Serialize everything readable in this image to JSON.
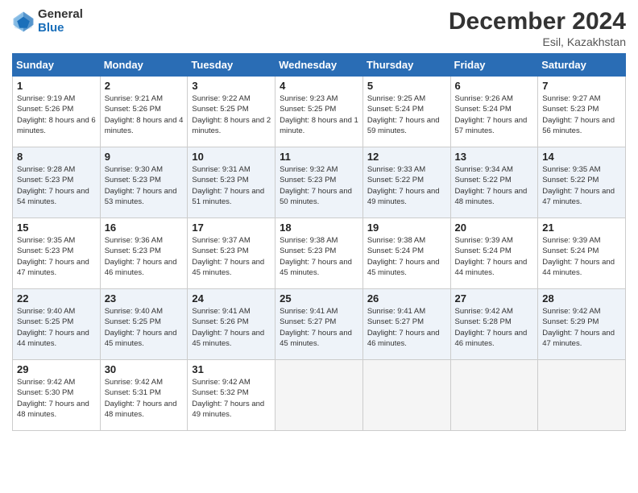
{
  "header": {
    "logo_text_general": "General",
    "logo_text_blue": "Blue",
    "month_title": "December 2024",
    "location": "Esil, Kazakhstan"
  },
  "days_of_week": [
    "Sunday",
    "Monday",
    "Tuesday",
    "Wednesday",
    "Thursday",
    "Friday",
    "Saturday"
  ],
  "weeks": [
    [
      {
        "day": "1",
        "sunrise": "9:19 AM",
        "sunset": "5:26 PM",
        "daylight": "8 hours and 6 minutes."
      },
      {
        "day": "2",
        "sunrise": "9:21 AM",
        "sunset": "5:26 PM",
        "daylight": "8 hours and 4 minutes."
      },
      {
        "day": "3",
        "sunrise": "9:22 AM",
        "sunset": "5:25 PM",
        "daylight": "8 hours and 2 minutes."
      },
      {
        "day": "4",
        "sunrise": "9:23 AM",
        "sunset": "5:25 PM",
        "daylight": "8 hours and 1 minute."
      },
      {
        "day": "5",
        "sunrise": "9:25 AM",
        "sunset": "5:24 PM",
        "daylight": "7 hours and 59 minutes."
      },
      {
        "day": "6",
        "sunrise": "9:26 AM",
        "sunset": "5:24 PM",
        "daylight": "7 hours and 57 minutes."
      },
      {
        "day": "7",
        "sunrise": "9:27 AM",
        "sunset": "5:23 PM",
        "daylight": "7 hours and 56 minutes."
      }
    ],
    [
      {
        "day": "8",
        "sunrise": "9:28 AM",
        "sunset": "5:23 PM",
        "daylight": "7 hours and 54 minutes."
      },
      {
        "day": "9",
        "sunrise": "9:30 AM",
        "sunset": "5:23 PM",
        "daylight": "7 hours and 53 minutes."
      },
      {
        "day": "10",
        "sunrise": "9:31 AM",
        "sunset": "5:23 PM",
        "daylight": "7 hours and 51 minutes."
      },
      {
        "day": "11",
        "sunrise": "9:32 AM",
        "sunset": "5:23 PM",
        "daylight": "7 hours and 50 minutes."
      },
      {
        "day": "12",
        "sunrise": "9:33 AM",
        "sunset": "5:22 PM",
        "daylight": "7 hours and 49 minutes."
      },
      {
        "day": "13",
        "sunrise": "9:34 AM",
        "sunset": "5:22 PM",
        "daylight": "7 hours and 48 minutes."
      },
      {
        "day": "14",
        "sunrise": "9:35 AM",
        "sunset": "5:22 PM",
        "daylight": "7 hours and 47 minutes."
      }
    ],
    [
      {
        "day": "15",
        "sunrise": "9:35 AM",
        "sunset": "5:23 PM",
        "daylight": "7 hours and 47 minutes."
      },
      {
        "day": "16",
        "sunrise": "9:36 AM",
        "sunset": "5:23 PM",
        "daylight": "7 hours and 46 minutes."
      },
      {
        "day": "17",
        "sunrise": "9:37 AM",
        "sunset": "5:23 PM",
        "daylight": "7 hours and 45 minutes."
      },
      {
        "day": "18",
        "sunrise": "9:38 AM",
        "sunset": "5:23 PM",
        "daylight": "7 hours and 45 minutes."
      },
      {
        "day": "19",
        "sunrise": "9:38 AM",
        "sunset": "5:24 PM",
        "daylight": "7 hours and 45 minutes."
      },
      {
        "day": "20",
        "sunrise": "9:39 AM",
        "sunset": "5:24 PM",
        "daylight": "7 hours and 44 minutes."
      },
      {
        "day": "21",
        "sunrise": "9:39 AM",
        "sunset": "5:24 PM",
        "daylight": "7 hours and 44 minutes."
      }
    ],
    [
      {
        "day": "22",
        "sunrise": "9:40 AM",
        "sunset": "5:25 PM",
        "daylight": "7 hours and 44 minutes."
      },
      {
        "day": "23",
        "sunrise": "9:40 AM",
        "sunset": "5:25 PM",
        "daylight": "7 hours and 45 minutes."
      },
      {
        "day": "24",
        "sunrise": "9:41 AM",
        "sunset": "5:26 PM",
        "daylight": "7 hours and 45 minutes."
      },
      {
        "day": "25",
        "sunrise": "9:41 AM",
        "sunset": "5:27 PM",
        "daylight": "7 hours and 45 minutes."
      },
      {
        "day": "26",
        "sunrise": "9:41 AM",
        "sunset": "5:27 PM",
        "daylight": "7 hours and 46 minutes."
      },
      {
        "day": "27",
        "sunrise": "9:42 AM",
        "sunset": "5:28 PM",
        "daylight": "7 hours and 46 minutes."
      },
      {
        "day": "28",
        "sunrise": "9:42 AM",
        "sunset": "5:29 PM",
        "daylight": "7 hours and 47 minutes."
      }
    ],
    [
      {
        "day": "29",
        "sunrise": "9:42 AM",
        "sunset": "5:30 PM",
        "daylight": "7 hours and 48 minutes."
      },
      {
        "day": "30",
        "sunrise": "9:42 AM",
        "sunset": "5:31 PM",
        "daylight": "7 hours and 48 minutes."
      },
      {
        "day": "31",
        "sunrise": "9:42 AM",
        "sunset": "5:32 PM",
        "daylight": "7 hours and 49 minutes."
      },
      null,
      null,
      null,
      null
    ]
  ]
}
